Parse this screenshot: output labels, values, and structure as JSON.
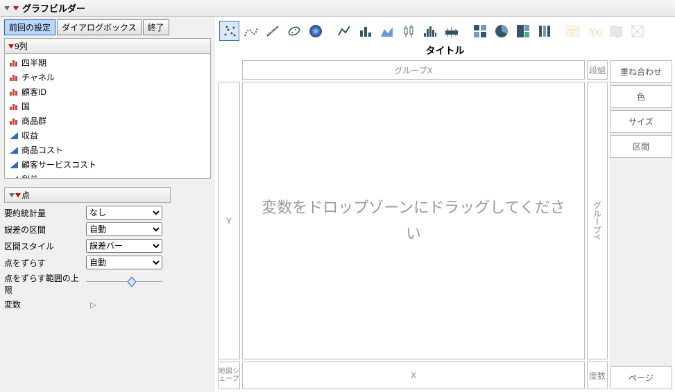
{
  "title": "グラフビルダー",
  "buttons": {
    "recall": "前回の設定",
    "dialog": "ダイアログボックス",
    "done": "終了"
  },
  "columns": {
    "header": "9列",
    "items": [
      {
        "name": "四半期",
        "type": "nominal"
      },
      {
        "name": "チャネル",
        "type": "nominal"
      },
      {
        "name": "顧客ID",
        "type": "nominal"
      },
      {
        "name": "国",
        "type": "nominal"
      },
      {
        "name": "商品群",
        "type": "nominal"
      },
      {
        "name": "収益",
        "type": "continuous"
      },
      {
        "name": "商品コスト",
        "type": "continuous"
      },
      {
        "name": "顧客サービスコスト",
        "type": "continuous"
      },
      {
        "name": "利益",
        "type": "continuous"
      }
    ]
  },
  "props": {
    "header": "点",
    "rows": {
      "summary_stat": {
        "label": "要約統計量",
        "value": "なし"
      },
      "error_interval": {
        "label": "誤差の区間",
        "value": "自動"
      },
      "interval_style": {
        "label": "区間スタイル",
        "value": "誤差バー"
      },
      "jitter": {
        "label": "点をずらす",
        "value": "自動"
      },
      "jitter_limit": {
        "label": "点をずらす範囲の上限"
      },
      "variables": {
        "label": "変数"
      }
    }
  },
  "plot": {
    "title_label": "タイトル",
    "zones": {
      "groupx": "グループX",
      "wrap": "段組",
      "y": "Y",
      "main": "変数をドロップゾーンにドラッグしてください",
      "groupy": "グループY",
      "map": "地図シェープ",
      "x": "X",
      "freq": "度数"
    },
    "right_buttons": {
      "overlay": "重ね合わせ",
      "color": "色",
      "size": "サイズ",
      "interval": "区間",
      "page": "ページ"
    }
  },
  "toolbar": {
    "icons": [
      "points",
      "smoother",
      "line-of-fit",
      "ellipse",
      "contour",
      "line",
      "bar",
      "area",
      "boxplot",
      "histogram",
      "heatmap",
      "mosaic",
      "pie",
      "treemap",
      "parallel",
      "caption",
      "formula",
      "map1",
      "map2"
    ],
    "selected": "points",
    "disabled": [
      "caption",
      "formula",
      "map1",
      "map2"
    ]
  }
}
